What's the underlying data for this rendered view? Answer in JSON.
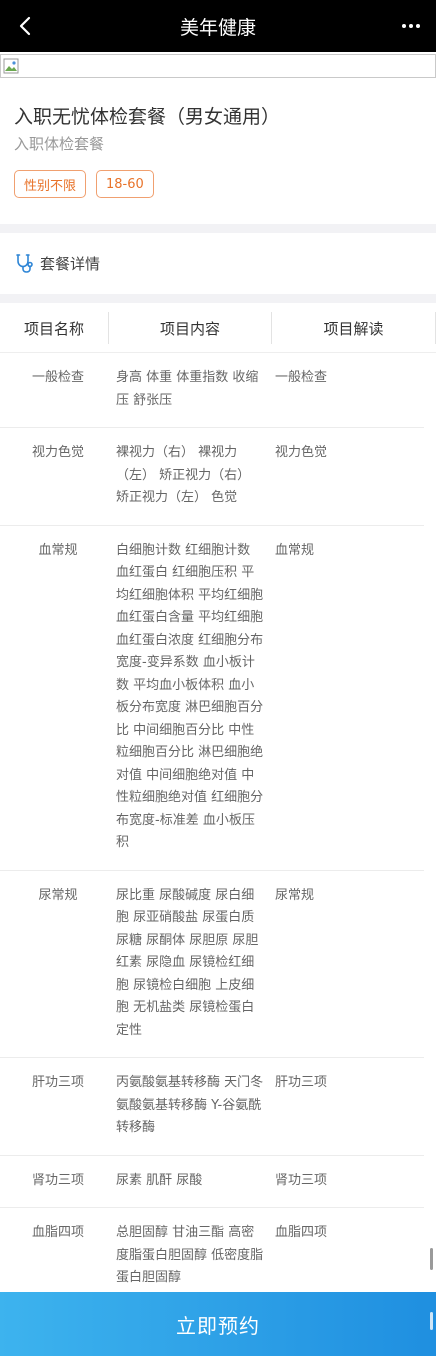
{
  "header": {
    "title": "美年健康",
    "back_icon": "chevron-left-icon",
    "more_icon": "more-dots-icon"
  },
  "package": {
    "title": "入职无忧体检套餐（男女通用）",
    "subtitle": "入职体检套餐",
    "tags": [
      "性别不限",
      "18-60"
    ]
  },
  "details": {
    "label": "套餐详情",
    "icon": "stethoscope-icon"
  },
  "table": {
    "headers": [
      "项目名称",
      "项目内容",
      "项目解读"
    ],
    "rows": [
      {
        "name": "一般检查",
        "content": "身高 体重 体重指数 收缩压 舒张压",
        "note": "一般检查"
      },
      {
        "name": "视力色觉",
        "content": "裸视力（右） 裸视力（左） 矫正视力（右） 矫正视力（左） 色觉",
        "note": "视力色觉"
      },
      {
        "name": "血常规",
        "content": "白细胞计数 红细胞计数 血红蛋白 红细胞压积 平均红细胞体积 平均红细胞血红蛋白含量 平均红细胞血红蛋白浓度 红细胞分布宽度-变异系数 血小板计数 平均血小板体积 血小板分布宽度 淋巴细胞百分比 中间细胞百分比 中性粒细胞百分比 淋巴细胞绝对值 中间细胞绝对值 中性粒细胞绝对值 红细胞分布宽度-标准差 血小板压积",
        "note": "血常规"
      },
      {
        "name": "尿常规",
        "content": "尿比重 尿酸碱度 尿白细胞 尿亚硝酸盐 尿蛋白质 尿糖 尿酮体 尿胆原 尿胆红素 尿隐血 尿镜检红细胞 尿镜检白细胞 上皮细胞 无机盐类 尿镜检蛋白定性",
        "note": "尿常规"
      },
      {
        "name": "肝功三项",
        "content": "丙氨酸氨基转移酶 天门冬氨酸氨基转移酶 Y-谷氨酰转移酶",
        "note": "肝功三项"
      },
      {
        "name": "肾功三项",
        "content": "尿素 肌酐 尿酸",
        "note": "肾功三项"
      },
      {
        "name": "血脂四项",
        "content": "总胆固醇 甘油三酯 高密度脂蛋白胆固醇 低密度脂蛋白胆固醇",
        "note": "血脂四项"
      }
    ]
  },
  "footer": {
    "book_label": "立即预约"
  },
  "colors": {
    "header_bg": "#000000",
    "tag_color": "#e8732a",
    "button_gradient_start": "#3db3ee",
    "button_gradient_end": "#1f8fe0"
  }
}
